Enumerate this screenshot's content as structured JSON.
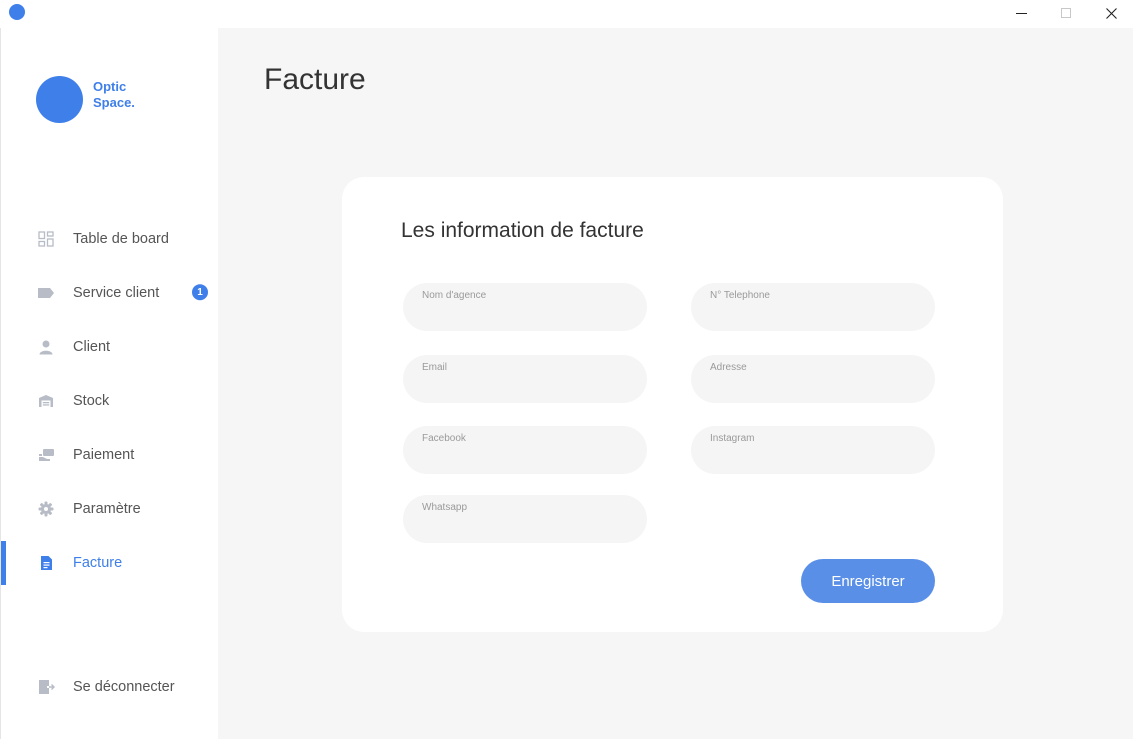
{
  "window": {
    "minimize_glyph": "",
    "maximize_glyph": "",
    "close_glyph": "✕"
  },
  "brand": {
    "line1": "Optic",
    "line2": "Space."
  },
  "nav": {
    "items": [
      {
        "label": "Table de board",
        "icon": "dashboard-icon"
      },
      {
        "label": "Service client",
        "icon": "tag-icon",
        "badge": "1"
      },
      {
        "label": "Client",
        "icon": "person-icon"
      },
      {
        "label": "Stock",
        "icon": "warehouse-icon"
      },
      {
        "label": "Paiement",
        "icon": "payment-icon"
      },
      {
        "label": "Paramètre",
        "icon": "gear-icon"
      },
      {
        "label": "Facture",
        "icon": "invoice-icon",
        "active": true
      }
    ],
    "logout": {
      "label": "Se déconnecter",
      "icon": "logout-icon"
    }
  },
  "page": {
    "title": "Facture"
  },
  "form": {
    "title": "Les information de facture",
    "fields": {
      "agency_name": "Nom d'agence",
      "phone": "N° Telephone",
      "email": "Email",
      "address": "Adresse",
      "facebook": "Facebook",
      "instagram": "Instagram",
      "whatsapp": "Whatsapp"
    },
    "submit_label": "Enregistrer"
  },
  "colors": {
    "accent": "#3f7fe9",
    "button": "#5a8fe8",
    "background": "#f6f6f6",
    "icon_inactive": "#b7bcc6"
  }
}
